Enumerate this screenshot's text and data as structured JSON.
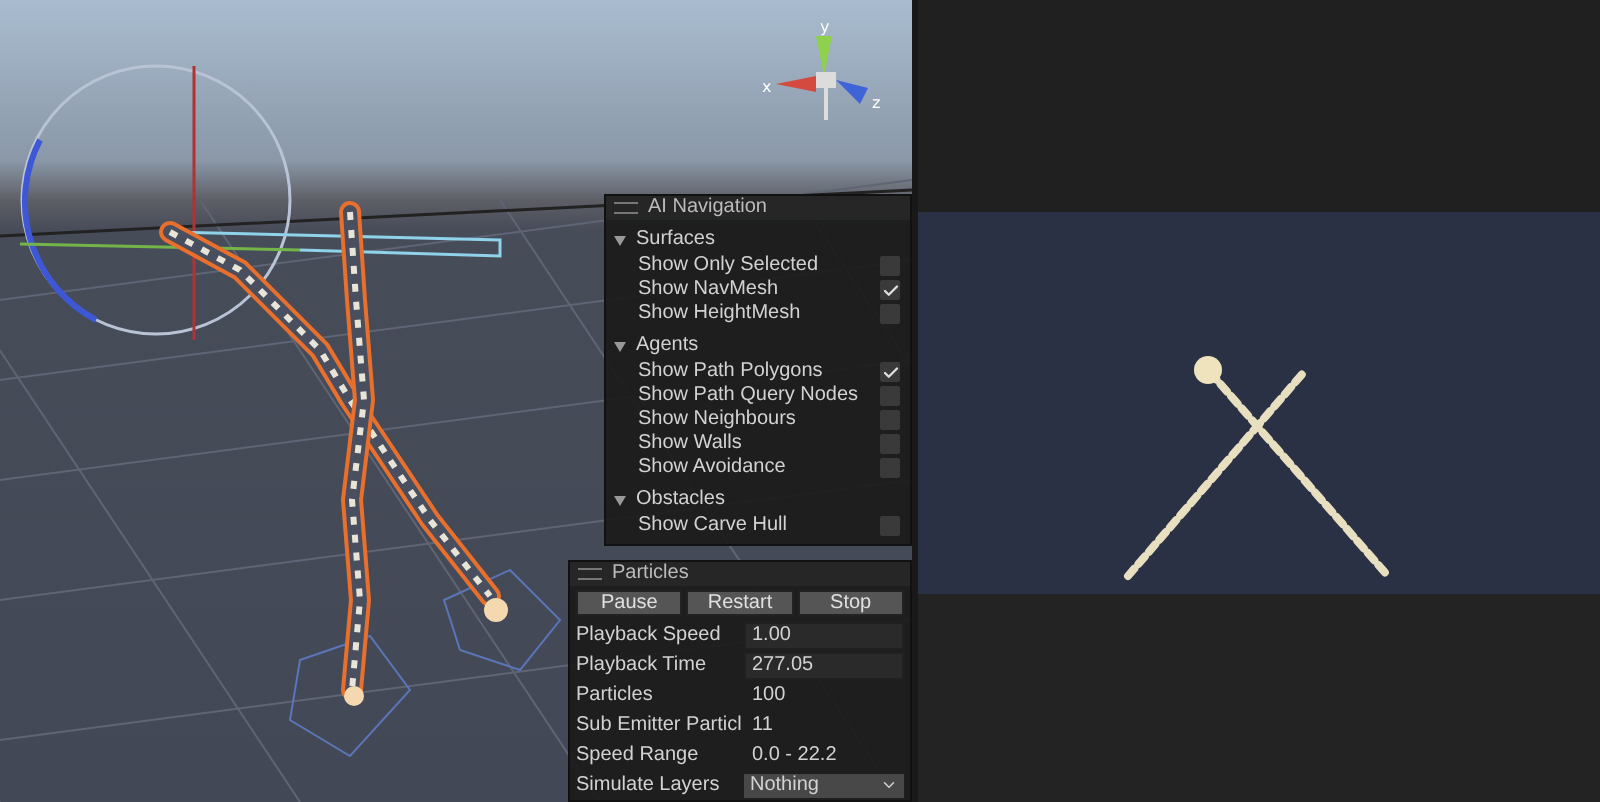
{
  "scene": {
    "gizmo_axes": [
      "y",
      "x",
      "z"
    ]
  },
  "navigation_overlay": {
    "title": "AI Navigation",
    "sections": [
      {
        "title": "Surfaces",
        "expanded": true,
        "options": [
          {
            "label": "Show Only Selected",
            "checked": false
          },
          {
            "label": "Show NavMesh",
            "checked": true
          },
          {
            "label": "Show HeightMesh",
            "checked": false
          }
        ]
      },
      {
        "title": "Agents",
        "expanded": true,
        "options": [
          {
            "label": "Show Path Polygons",
            "checked": true
          },
          {
            "label": "Show Path Query Nodes",
            "checked": false
          },
          {
            "label": "Show Neighbours",
            "checked": false
          },
          {
            "label": "Show Walls",
            "checked": false
          },
          {
            "label": "Show Avoidance",
            "checked": false
          }
        ]
      },
      {
        "title": "Obstacles",
        "expanded": true,
        "options": [
          {
            "label": "Show Carve Hull",
            "checked": false
          }
        ]
      }
    ]
  },
  "particles_overlay": {
    "title": "Particles",
    "buttons": [
      "Pause",
      "Restart",
      "Stop"
    ],
    "fields": [
      {
        "label": "Playback Speed",
        "value": "1.00",
        "kind": "input"
      },
      {
        "label": "Playback Time",
        "value": "277.05",
        "kind": "input"
      },
      {
        "label": "Particles",
        "value": "100",
        "kind": "text"
      },
      {
        "label": "Sub Emitter Particl",
        "value": "11",
        "kind": "text"
      },
      {
        "label": "Speed Range",
        "value": "0.0 - 22.2",
        "kind": "text"
      },
      {
        "label": "Simulate Layers",
        "value": "Nothing",
        "kind": "dropdown"
      }
    ]
  }
}
